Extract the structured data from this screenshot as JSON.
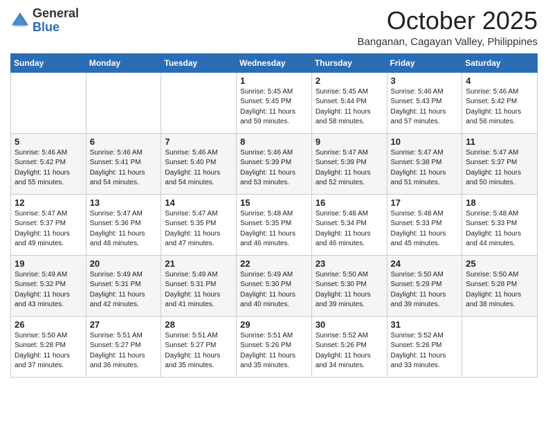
{
  "header": {
    "logo_general": "General",
    "logo_blue": "Blue",
    "month_title": "October 2025",
    "subtitle": "Banganan, Cagayan Valley, Philippines"
  },
  "calendar": {
    "days_of_week": [
      "Sunday",
      "Monday",
      "Tuesday",
      "Wednesday",
      "Thursday",
      "Friday",
      "Saturday"
    ],
    "weeks": [
      [
        {
          "day": "",
          "info": ""
        },
        {
          "day": "",
          "info": ""
        },
        {
          "day": "",
          "info": ""
        },
        {
          "day": "1",
          "info": "Sunrise: 5:45 AM\nSunset: 5:45 PM\nDaylight: 11 hours\nand 59 minutes."
        },
        {
          "day": "2",
          "info": "Sunrise: 5:45 AM\nSunset: 5:44 PM\nDaylight: 11 hours\nand 58 minutes."
        },
        {
          "day": "3",
          "info": "Sunrise: 5:46 AM\nSunset: 5:43 PM\nDaylight: 11 hours\nand 57 minutes."
        },
        {
          "day": "4",
          "info": "Sunrise: 5:46 AM\nSunset: 5:42 PM\nDaylight: 11 hours\nand 56 minutes."
        }
      ],
      [
        {
          "day": "5",
          "info": "Sunrise: 5:46 AM\nSunset: 5:42 PM\nDaylight: 11 hours\nand 55 minutes."
        },
        {
          "day": "6",
          "info": "Sunrise: 5:46 AM\nSunset: 5:41 PM\nDaylight: 11 hours\nand 54 minutes."
        },
        {
          "day": "7",
          "info": "Sunrise: 5:46 AM\nSunset: 5:40 PM\nDaylight: 11 hours\nand 54 minutes."
        },
        {
          "day": "8",
          "info": "Sunrise: 5:46 AM\nSunset: 5:39 PM\nDaylight: 11 hours\nand 53 minutes."
        },
        {
          "day": "9",
          "info": "Sunrise: 5:47 AM\nSunset: 5:39 PM\nDaylight: 11 hours\nand 52 minutes."
        },
        {
          "day": "10",
          "info": "Sunrise: 5:47 AM\nSunset: 5:38 PM\nDaylight: 11 hours\nand 51 minutes."
        },
        {
          "day": "11",
          "info": "Sunrise: 5:47 AM\nSunset: 5:37 PM\nDaylight: 11 hours\nand 50 minutes."
        }
      ],
      [
        {
          "day": "12",
          "info": "Sunrise: 5:47 AM\nSunset: 5:37 PM\nDaylight: 11 hours\nand 49 minutes."
        },
        {
          "day": "13",
          "info": "Sunrise: 5:47 AM\nSunset: 5:36 PM\nDaylight: 11 hours\nand 48 minutes."
        },
        {
          "day": "14",
          "info": "Sunrise: 5:47 AM\nSunset: 5:35 PM\nDaylight: 11 hours\nand 47 minutes."
        },
        {
          "day": "15",
          "info": "Sunrise: 5:48 AM\nSunset: 5:35 PM\nDaylight: 11 hours\nand 46 minutes."
        },
        {
          "day": "16",
          "info": "Sunrise: 5:48 AM\nSunset: 5:34 PM\nDaylight: 11 hours\nand 46 minutes."
        },
        {
          "day": "17",
          "info": "Sunrise: 5:48 AM\nSunset: 5:33 PM\nDaylight: 11 hours\nand 45 minutes."
        },
        {
          "day": "18",
          "info": "Sunrise: 5:48 AM\nSunset: 5:33 PM\nDaylight: 11 hours\nand 44 minutes."
        }
      ],
      [
        {
          "day": "19",
          "info": "Sunrise: 5:49 AM\nSunset: 5:32 PM\nDaylight: 11 hours\nand 43 minutes."
        },
        {
          "day": "20",
          "info": "Sunrise: 5:49 AM\nSunset: 5:31 PM\nDaylight: 11 hours\nand 42 minutes."
        },
        {
          "day": "21",
          "info": "Sunrise: 5:49 AM\nSunset: 5:31 PM\nDaylight: 11 hours\nand 41 minutes."
        },
        {
          "day": "22",
          "info": "Sunrise: 5:49 AM\nSunset: 5:30 PM\nDaylight: 11 hours\nand 40 minutes."
        },
        {
          "day": "23",
          "info": "Sunrise: 5:50 AM\nSunset: 5:30 PM\nDaylight: 11 hours\nand 39 minutes."
        },
        {
          "day": "24",
          "info": "Sunrise: 5:50 AM\nSunset: 5:29 PM\nDaylight: 11 hours\nand 39 minutes."
        },
        {
          "day": "25",
          "info": "Sunrise: 5:50 AM\nSunset: 5:28 PM\nDaylight: 11 hours\nand 38 minutes."
        }
      ],
      [
        {
          "day": "26",
          "info": "Sunrise: 5:50 AM\nSunset: 5:28 PM\nDaylight: 11 hours\nand 37 minutes."
        },
        {
          "day": "27",
          "info": "Sunrise: 5:51 AM\nSunset: 5:27 PM\nDaylight: 11 hours\nand 36 minutes."
        },
        {
          "day": "28",
          "info": "Sunrise: 5:51 AM\nSunset: 5:27 PM\nDaylight: 11 hours\nand 35 minutes."
        },
        {
          "day": "29",
          "info": "Sunrise: 5:51 AM\nSunset: 5:26 PM\nDaylight: 11 hours\nand 35 minutes."
        },
        {
          "day": "30",
          "info": "Sunrise: 5:52 AM\nSunset: 5:26 PM\nDaylight: 11 hours\nand 34 minutes."
        },
        {
          "day": "31",
          "info": "Sunrise: 5:52 AM\nSunset: 5:26 PM\nDaylight: 11 hours\nand 33 minutes."
        },
        {
          "day": "",
          "info": ""
        }
      ]
    ]
  }
}
